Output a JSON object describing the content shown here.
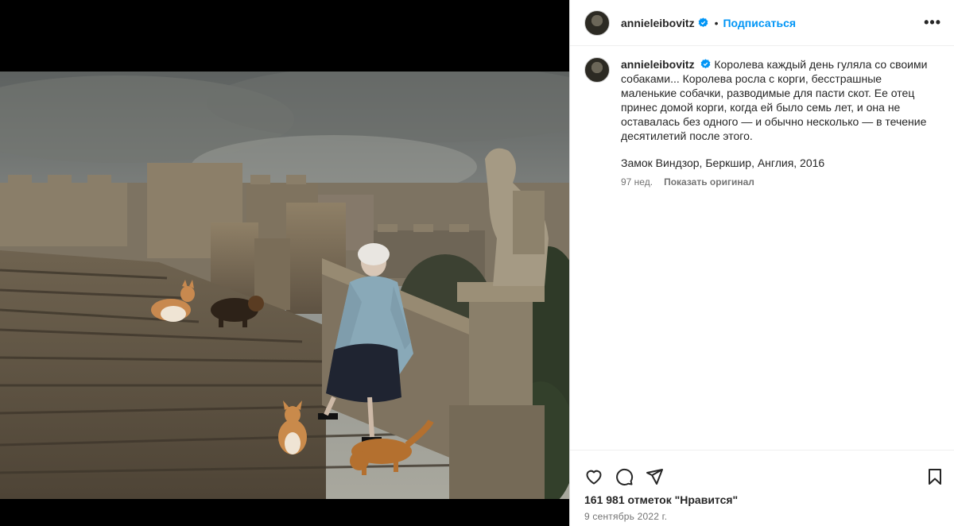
{
  "post": {
    "author": "annieleibovitz",
    "follow_label": "Подписаться",
    "more_label": "•••",
    "caption": "Королева каждый день гуляла со своими собаками... Королева росла с корги, бесстрашные маленькие собачки, разводимые для пасти скот. Ее отец принес домой корги, когда ей было семь лет, и она не оставалась без одного — и обычно несколько — в течение десятилетий после этого.",
    "location_line": "Замок Виндзор, Беркшир, Англия, 2016",
    "age": "97 нед.",
    "show_original": "Показать оригинал",
    "likes": "161 981 отметок \"Нравится\"",
    "date": "9 сентябрь 2022 г."
  },
  "icons": {
    "verified": "verified-badge-icon",
    "like": "heart-icon",
    "comment": "comment-icon",
    "share": "paper-plane-icon",
    "save": "bookmark-icon"
  },
  "colors": {
    "accent": "#0095f6",
    "text": "#262626",
    "muted": "#737373"
  }
}
